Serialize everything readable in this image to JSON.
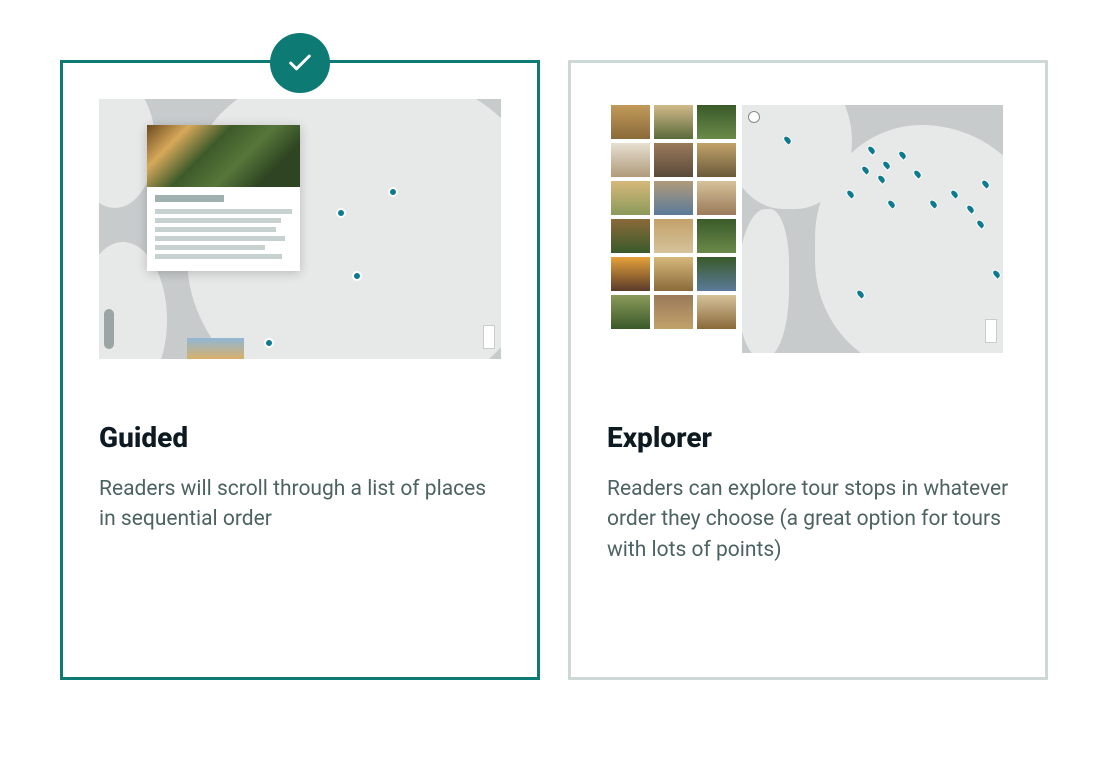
{
  "options": [
    {
      "key": "guided",
      "title": "Guided",
      "description": "Readers will scroll through a list of places in sequential order",
      "selected": true
    },
    {
      "key": "explorer",
      "title": "Explorer",
      "description": "Readers can explore tour stops in whatever order they choose (a great option for tours with lots of points)",
      "selected": false
    }
  ],
  "colors": {
    "accent": "#0d7a73",
    "border_inactive": "#cdd8d7",
    "text_heading": "#0e1a22",
    "text_body": "#4c6361"
  }
}
